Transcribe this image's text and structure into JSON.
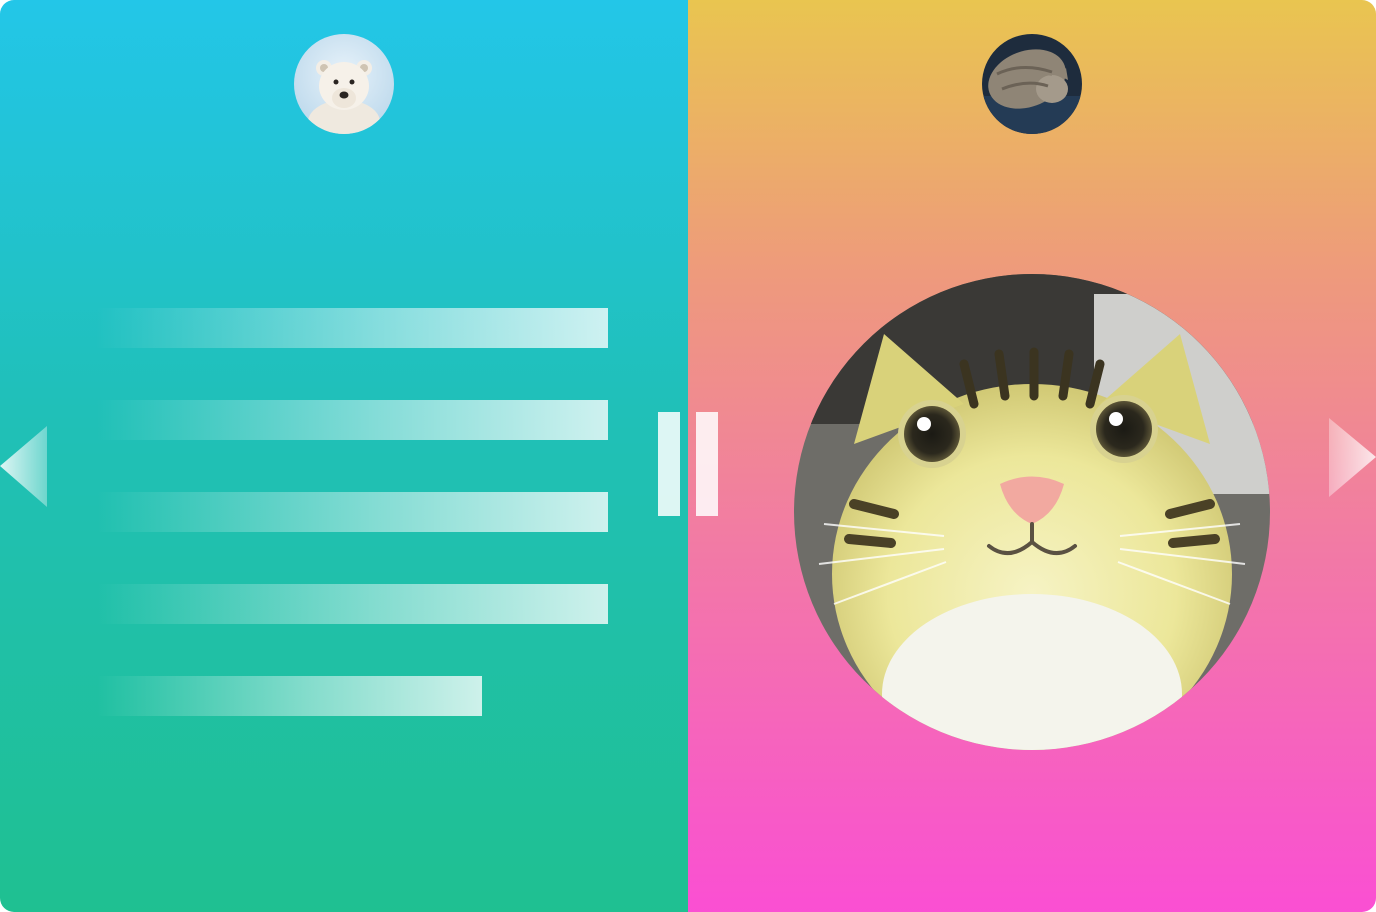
{
  "app": {
    "colors": {
      "left_gradient": [
        "#23c6e8",
        "#1fc091"
      ],
      "right_gradient": [
        "#e9c550",
        "#fa4fd3"
      ]
    }
  },
  "left_panel": {
    "avatar": {
      "icon": "polar-bear-avatar"
    },
    "text_bars_count": 5
  },
  "right_panel": {
    "avatar": {
      "icon": "cat-avatar"
    },
    "photo": {
      "icon": "smiling-cat-photo"
    }
  },
  "controls": {
    "prev": {
      "icon": "chevron-left-icon"
    },
    "next": {
      "icon": "chevron-right-icon"
    },
    "splitter": {
      "icon": "drag-handle-icon"
    }
  }
}
